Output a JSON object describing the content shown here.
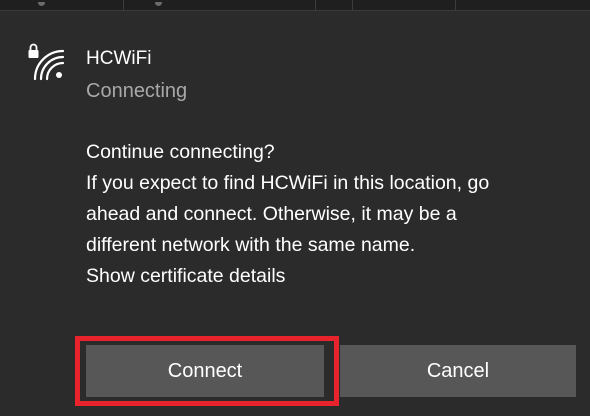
{
  "network": {
    "name": "HCWiFi",
    "status": "Connecting",
    "icon": "secured-wifi-icon"
  },
  "message": {
    "line1": "Continue connecting?",
    "line2": "If you expect to find HCWiFi in this location, go",
    "line3": "ahead and connect. Otherwise, it may be a",
    "line4": "different network with the same name.",
    "link": "Show certificate details"
  },
  "buttons": {
    "connect": "Connect",
    "cancel": "Cancel"
  },
  "colors": {
    "panel_background": "#2b2b2b",
    "button_background": "#575757",
    "highlight": "#e8232b",
    "secondary_text": "#a8a8a8"
  }
}
